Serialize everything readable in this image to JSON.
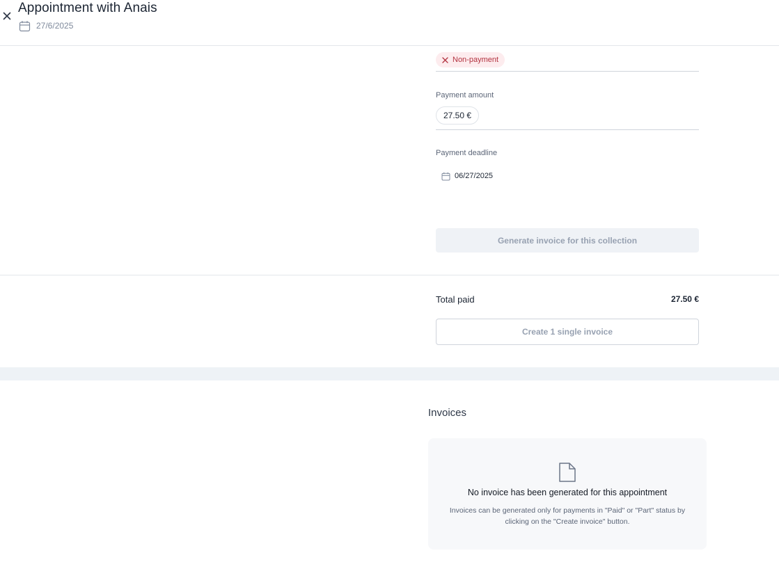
{
  "header": {
    "title": "Appointment with Anais",
    "date": "27/6/2025"
  },
  "payment": {
    "status_chip": "Non-payment",
    "amount_label": "Payment amount",
    "amount_value": "27.50 €",
    "deadline_label": "Payment deadline",
    "deadline_value": "06/27/2025",
    "generate_button": "Generate invoice for this collection"
  },
  "totals": {
    "label": "Total paid",
    "value": "27.50 €",
    "create_button": "Create 1 single invoice"
  },
  "invoices": {
    "title": "Invoices",
    "empty_title": "No invoice has been generated for this appointment",
    "empty_description": "Invoices can be generated only for payments in \"Paid\" or \"Part\" status by clicking on the \"Create invoice\" button."
  },
  "icons": {
    "close": "close-icon",
    "calendar": "calendar-icon",
    "status_x": "x-icon",
    "document": "document-icon"
  },
  "colors": {
    "chip_bg": "#fdecee",
    "chip_text": "#b2323f",
    "disabled_text": "#97a1b1"
  }
}
